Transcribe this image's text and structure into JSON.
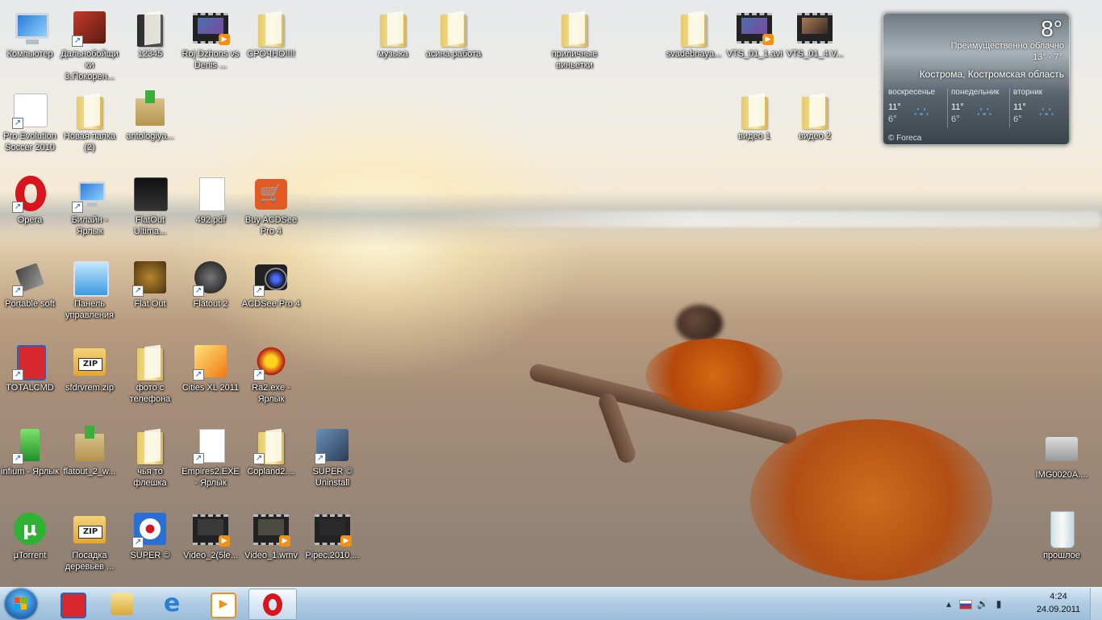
{
  "desktop": {
    "icons": [
      {
        "label": "Компьютер",
        "kind": "computer"
      },
      {
        "label": "Дальнобойщики 3.Покорен...",
        "kind": "truck"
      },
      {
        "label": "12345",
        "kind": "folder-dark"
      },
      {
        "label": "Roj Dzhons vs Denis ...",
        "kind": "video"
      },
      {
        "label": "СРОЧНО!!!!",
        "kind": "folder"
      },
      {
        "label": "музыка",
        "kind": "folder"
      },
      {
        "label": "асина работа",
        "kind": "folder"
      },
      {
        "label": "приличные виньетки",
        "kind": "folder"
      },
      {
        "label": "svadebnaya...",
        "kind": "folder"
      },
      {
        "label": "VTS_01_1.avi",
        "kind": "video"
      },
      {
        "label": "VTS_01_4.V...",
        "kind": "video"
      },
      {
        "label": "Pro Evolution Soccer 2010",
        "kind": "pes"
      },
      {
        "label": "Новая папка (2)",
        "kind": "folder"
      },
      {
        "label": "antologiya...",
        "kind": "box"
      },
      {
        "label": "видео 1",
        "kind": "folder"
      },
      {
        "label": "видео 2",
        "kind": "folder"
      },
      {
        "label": "Opera",
        "kind": "opera"
      },
      {
        "label": "Билайн - Ярлык",
        "kind": "network"
      },
      {
        "label": "FlatOut Ultima...",
        "kind": "flatout"
      },
      {
        "label": "492.pdf",
        "kind": "doc"
      },
      {
        "label": "Buy ACDSee Pro 4",
        "kind": "cart"
      },
      {
        "label": "Portable soft",
        "kind": "usb"
      },
      {
        "label": "Панель управления",
        "kind": "control"
      },
      {
        "label": "Flat Out",
        "kind": "flatout"
      },
      {
        "label": "Flatout 2",
        "kind": "flatout2"
      },
      {
        "label": "ACDSee Pro 4",
        "kind": "camera"
      },
      {
        "label": "TOTALCMD",
        "kind": "disk"
      },
      {
        "label": "sfdrvrem.zip",
        "kind": "zip"
      },
      {
        "label": "фото с телефона",
        "kind": "folder"
      },
      {
        "label": "Cities XL 2011",
        "kind": "citiesxl"
      },
      {
        "label": "Ra2.exe - Ярлык",
        "kind": "ra2"
      },
      {
        "label": "infium - Ярлык",
        "kind": "infium"
      },
      {
        "label": "flatout_2_w...",
        "kind": "box"
      },
      {
        "label": "чья то флешка",
        "kind": "folder"
      },
      {
        "label": "Empires2.EXE - Ярлык",
        "kind": "doc"
      },
      {
        "label": "Copland2....",
        "kind": "folder"
      },
      {
        "label": "SUPER © Uninstall",
        "kind": "super-uninstall"
      },
      {
        "label": "µTorrent",
        "kind": "utorrent"
      },
      {
        "label": "Посадка деревьев ...",
        "kind": "zip"
      },
      {
        "label": "SUPER ©",
        "kind": "super"
      },
      {
        "label": "Video_2(5le...",
        "kind": "video"
      },
      {
        "label": "Video_1.wmv",
        "kind": "video"
      },
      {
        "label": "Pipec.2010....",
        "kind": "video"
      },
      {
        "label": "IMG0020A....",
        "kind": "printer"
      },
      {
        "label": "прошлое",
        "kind": "trash"
      }
    ]
  },
  "weather": {
    "temperature": "8°",
    "condition": "Преимущественно облачно",
    "range": "13°  -  7°",
    "city": "Кострома, Костромская область",
    "forecast": [
      {
        "day": "воскресенье",
        "high": "11°",
        "low": "6°"
      },
      {
        "day": "понедельник",
        "high": "11°",
        "low": "6°"
      },
      {
        "day": "вторник",
        "high": "11°",
        "low": "6°"
      }
    ],
    "credit": "© Foreca"
  },
  "taskbar": {
    "pinned": [
      {
        "name": "totalcmd",
        "color": "#d9272e"
      },
      {
        "name": "explorer",
        "color": "#e3b53c"
      },
      {
        "name": "internet-explorer",
        "color": "#2a7fd6"
      },
      {
        "name": "media-player",
        "color": "#f19017"
      },
      {
        "name": "opera",
        "color": "#d8141d"
      }
    ],
    "clock": {
      "time": "4:24",
      "date": "24.09.2011"
    }
  }
}
